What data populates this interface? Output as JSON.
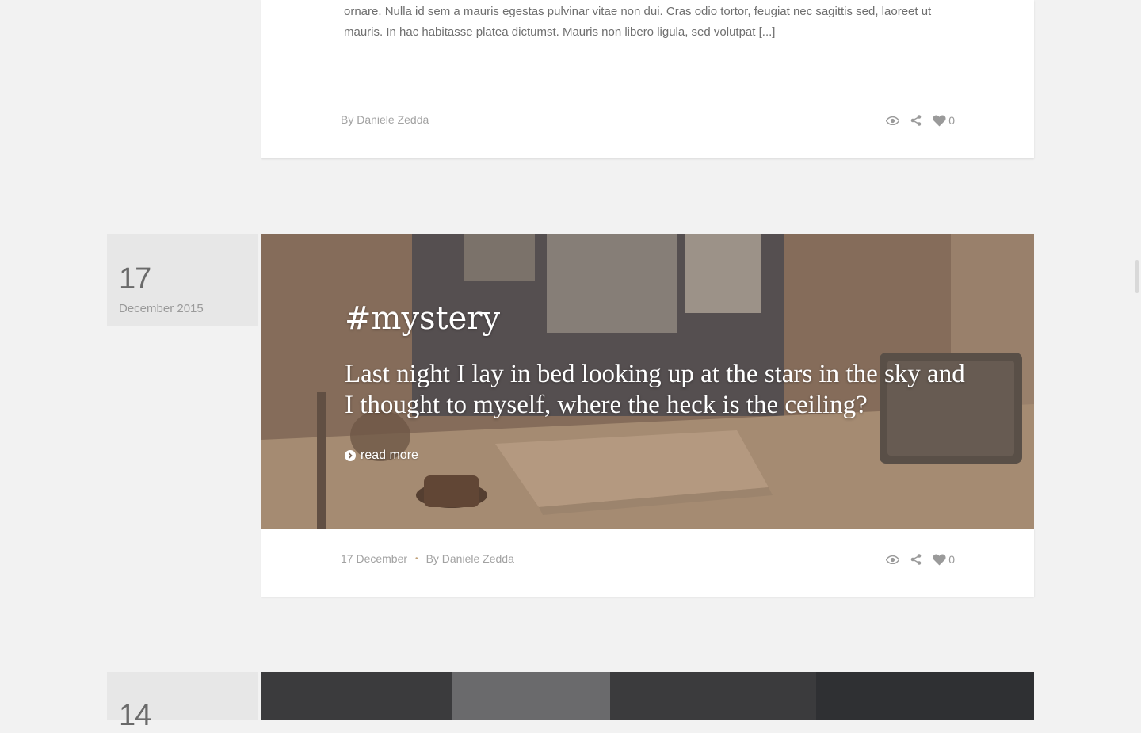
{
  "post_prev": {
    "excerpt": "ornare. Nulla id sem a mauris egestas pulvinar vitae non dui. Cras odio tortor, feugiat nec sagittis sed, laoreet ut mauris. In hac habitasse platea dictumst. Mauris non libero ligula, sed volutpat [...]",
    "author": "By Daniele Zedda",
    "likes": "0",
    "icons": [
      "eye-icon",
      "share-icon",
      "heart-icon"
    ]
  },
  "post_mystery": {
    "date_day": "17",
    "date_month": "December 2015",
    "tag": "#mystery",
    "quote": "Last night I lay in bed looking up at the stars in the sky and I thought to myself, where the heck is the ceiling?",
    "read_more": "read more",
    "meta_date": "17 December",
    "meta_separator": "•",
    "author": "By Daniele Zedda",
    "likes": "0",
    "icons": [
      "eye-icon",
      "share-icon",
      "heart-icon"
    ]
  },
  "post_next": {
    "date_day": "14"
  },
  "colors": {
    "background": "#f2f2f2",
    "card": "#ffffff",
    "date_box": "#e7e7e7",
    "meta_text": "#a2a2a2",
    "separator_dot": "#c2a27a"
  }
}
